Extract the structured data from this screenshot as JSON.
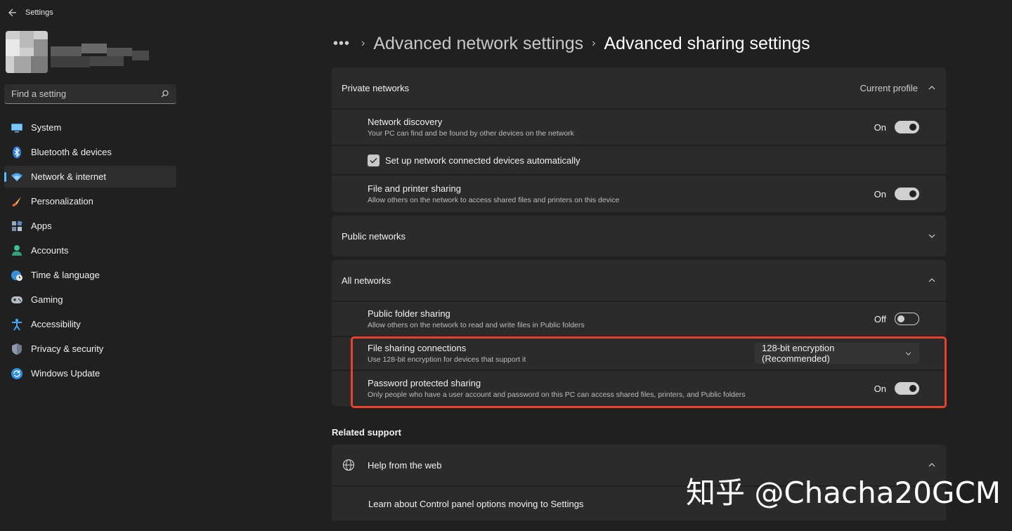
{
  "app": {
    "title": "Settings"
  },
  "search": {
    "placeholder": "Find a setting"
  },
  "sidebar": {
    "items": [
      {
        "label": "System",
        "icon": "monitor-icon"
      },
      {
        "label": "Bluetooth & devices",
        "icon": "bluetooth-icon"
      },
      {
        "label": "Network & internet",
        "icon": "wifi-icon",
        "active": true
      },
      {
        "label": "Personalization",
        "icon": "brush-icon"
      },
      {
        "label": "Apps",
        "icon": "apps-icon"
      },
      {
        "label": "Accounts",
        "icon": "person-icon"
      },
      {
        "label": "Time & language",
        "icon": "globe-clock-icon"
      },
      {
        "label": "Gaming",
        "icon": "gamepad-icon"
      },
      {
        "label": "Accessibility",
        "icon": "accessibility-icon"
      },
      {
        "label": "Privacy & security",
        "icon": "shield-icon"
      },
      {
        "label": "Windows Update",
        "icon": "update-icon"
      }
    ]
  },
  "breadcrumb": {
    "more": "•••",
    "parent": "Advanced network settings",
    "current": "Advanced sharing settings"
  },
  "private_networks": {
    "title": "Private networks",
    "meta": "Current profile",
    "network_discovery": {
      "label": "Network discovery",
      "desc": "Your PC can find and be found by other devices on the network",
      "state": "On"
    },
    "auto_setup": {
      "label": "Set up network connected devices automatically",
      "checked": true
    },
    "file_printer": {
      "label": "File and printer sharing",
      "desc": "Allow others on the network to access shared files and printers on this device",
      "state": "On"
    }
  },
  "public_networks": {
    "title": "Public networks"
  },
  "all_networks": {
    "title": "All networks",
    "public_folder": {
      "label": "Public folder sharing",
      "desc": "Allow others on the network to read and write files in Public folders",
      "state": "Off"
    },
    "file_connections": {
      "label": "File sharing connections",
      "desc": "Use 128-bit encryption for devices that support it",
      "value": "128-bit encryption (Recommended)"
    },
    "password_protected": {
      "label": "Password protected sharing",
      "desc": "Only people who have a user account and password on this PC can access shared files, printers, and Public folders",
      "state": "On"
    }
  },
  "related_support": {
    "heading": "Related support",
    "help_web": "Help from the web",
    "learn_link": "Learn about Control panel options moving to Settings"
  },
  "watermark": "知乎 @Chacha20GCM",
  "colors": {
    "accent": "#4cc2ff",
    "highlight": "#e8432a",
    "background": "#202020",
    "card": "#2b2b2b"
  }
}
